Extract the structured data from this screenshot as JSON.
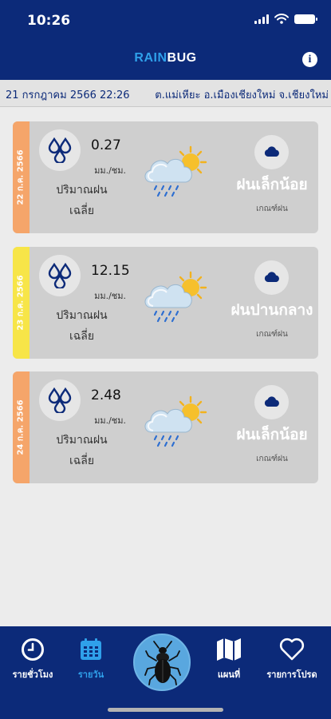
{
  "status_bar": {
    "time": "10:26"
  },
  "app": {
    "logo_part1": "RAIN",
    "logo_part2": "BUG",
    "info_icon": "info-circle-icon"
  },
  "location_bar": {
    "datetime": "21 กรกฎาคม 2566 22:26",
    "place": "ต.แม่เหียะ อ.เมืองเชียงใหม่ จ.เชียงใหม่"
  },
  "forecast": [
    {
      "date": "22 ก.ค. 2566",
      "strip_color": "#f5a56a",
      "amount": "0.27",
      "unit": "มม./ชม.",
      "avg_label_line1": "ปริมาณฝน",
      "avg_label_line2": "เฉลี่ย",
      "level": "ฝนเล็กน้อย",
      "criteria": "เกณฑ์ฝน",
      "weather_icon": "sun-cloud-rain-icon"
    },
    {
      "date": "23 ก.ค. 2566",
      "strip_color": "#f7e548",
      "amount": "12.15",
      "unit": "มม./ชม.",
      "avg_label_line1": "ปริมาณฝน",
      "avg_label_line2": "เฉลี่ย",
      "level": "ฝนปานกลาง",
      "criteria": "เกณฑ์ฝน",
      "weather_icon": "sun-cloud-rain-icon"
    },
    {
      "date": "24 ก.ค. 2566",
      "strip_color": "#f5a56a",
      "amount": "2.48",
      "unit": "มม./ชม.",
      "avg_label_line1": "ปริมาณฝน",
      "avg_label_line2": "เฉลี่ย",
      "level": "ฝนเล็กน้อย",
      "criteria": "เกณฑ์ฝน",
      "weather_icon": "sun-cloud-rain-icon"
    }
  ],
  "bottom_nav": {
    "hourly": "รายชั่วโมง",
    "daily": "รายวัน",
    "map": "แผนที่",
    "favorites": "รายการโปรด"
  },
  "colors": {
    "primary": "#0c2a79",
    "accent": "#2fa0ea",
    "card_bg": "#cfcfcf"
  }
}
